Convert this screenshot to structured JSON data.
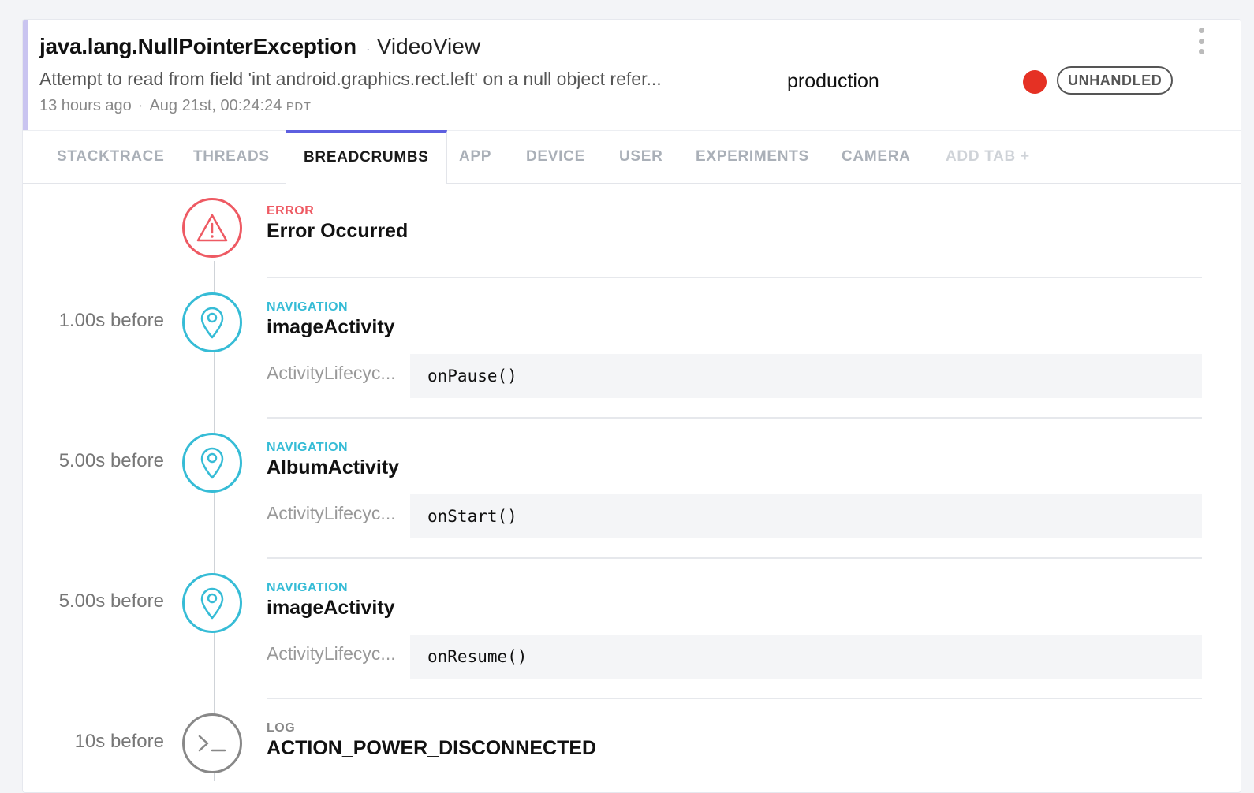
{
  "header": {
    "error_class": "java.lang.NullPointerException",
    "separator": "·",
    "context": "VideoView",
    "message": "Attempt to read from field 'int android.graphics.rect.left' on a null object refer...",
    "time_ago": "13 hours ago",
    "time_sep": "·",
    "timestamp": "Aug 21st, 00:24:24",
    "timezone": "PDT",
    "release_stage": "production",
    "severity_color": "#e53124",
    "handled_badge": "UNHANDLED"
  },
  "tabs": [
    {
      "label": "STACKTRACE",
      "active": false
    },
    {
      "label": "THREADS",
      "active": false
    },
    {
      "label": "BREADCRUMBS",
      "active": true
    },
    {
      "label": "APP",
      "active": false
    },
    {
      "label": "DEVICE",
      "active": false
    },
    {
      "label": "USER",
      "active": false
    },
    {
      "label": "EXPERIMENTS",
      "active": false
    },
    {
      "label": "CAMERA",
      "active": false
    },
    {
      "label": "ADD TAB +",
      "active": false
    }
  ],
  "breadcrumbs": [
    {
      "offset": "",
      "type": "ERROR",
      "icon": "warning-icon",
      "name": "Error Occurred"
    },
    {
      "offset": "1.00s before",
      "type": "NAVIGATION",
      "icon": "map-pin-icon",
      "name": "imageActivity",
      "meta_key": "ActivityLifecyc...",
      "meta_value": "onPause()"
    },
    {
      "offset": "5.00s before",
      "type": "NAVIGATION",
      "icon": "map-pin-icon",
      "name": "AlbumActivity",
      "meta_key": "ActivityLifecyc...",
      "meta_value": "onStart()"
    },
    {
      "offset": "5.00s before",
      "type": "NAVIGATION",
      "icon": "map-pin-icon",
      "name": "imageActivity",
      "meta_key": "ActivityLifecyc...",
      "meta_value": "onResume()"
    },
    {
      "offset": "10s before",
      "type": "LOG",
      "icon": "terminal-icon",
      "name": "ACTION_POWER_DISCONNECTED"
    }
  ],
  "colors": {
    "accent": "#5d5fe0",
    "error": "#ee5a63",
    "navigation": "#36bcd6",
    "log": "#888888"
  }
}
